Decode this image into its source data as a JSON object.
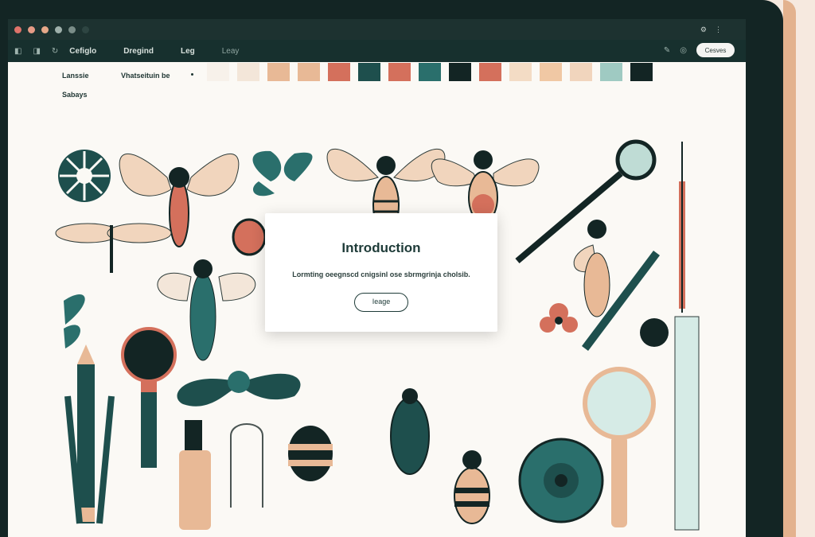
{
  "colors": {
    "frame": "#132524",
    "titlebar": "#1d3230",
    "toolbar": "#17302e",
    "accent_teal": "#1e3b38",
    "peach": "#e8b996",
    "terracotta": "#d4705c"
  },
  "titlebar": {
    "controls": [
      "#e0736a",
      "#e79b86",
      "#e7a889",
      "#9fb0ab",
      "#7a8d88"
    ]
  },
  "toolbar": {
    "menu": [
      "Cefiglo",
      "Dregind",
      "Leg",
      "Leay"
    ],
    "button_label": "Cesves"
  },
  "header": {
    "label_a": "Lanssie",
    "label_b": "Vhatseituin be",
    "label_c": "Sabays"
  },
  "palette": [
    "#f7f1ea",
    "#f3e6d9",
    "#e8b996",
    "#e8b996",
    "#d4705c",
    "#1e4f4d",
    "#d4705c",
    "#2a6f6c",
    "#132524",
    "#d4705c",
    "#f3dcc5",
    "#f0c8a4",
    "#f1d5bd",
    "#9fcac2",
    "#132524"
  ],
  "modal": {
    "title": "Introduction",
    "text": "Lormting oeegnscd cnigsinl ose sbrmgrinja cholsib.",
    "button": "Ieage"
  }
}
